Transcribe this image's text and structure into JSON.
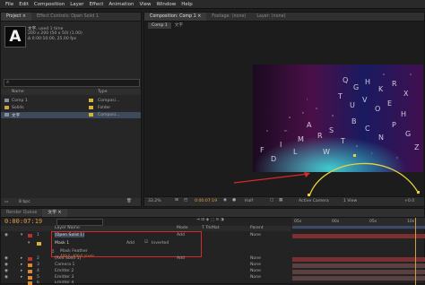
{
  "menu": [
    "File",
    "Edit",
    "Composition",
    "Layer",
    "Effect",
    "Animation",
    "View",
    "Window",
    "Help"
  ],
  "project": {
    "tabs": [
      "Project ×",
      "Effect Controls: Open Solid 1"
    ],
    "item_title": "文字",
    "item_used": ", used 1 time",
    "item_dims": "200 x 200 (50 x 50) (1.00)",
    "item_dur": "Δ 0:00:10:00, 25.00 fps",
    "search_placeholder": "",
    "col_name": "Name",
    "col_type": "Type",
    "rows": [
      {
        "name": "Comp 1",
        "type": "Composi..."
      },
      {
        "name": "Solids",
        "type": "Folder"
      },
      {
        "name": "文字",
        "type": "Composi..."
      }
    ],
    "bpc": "8 bpc"
  },
  "comp": {
    "tabs": [
      "Composition: Comp 1 ×",
      "Footage: (none)",
      "Layer: (none)"
    ],
    "subtabs": [
      "Comp 1",
      "文字"
    ],
    "zoom": "33.2%",
    "time": "0:00:07:19",
    "res": "Half",
    "camera": "Active Camera",
    "views": "1 View",
    "offset": "+0.0"
  },
  "timeline": {
    "tabs": [
      "Render Queue",
      "文字 ×"
    ],
    "time": "0:00:07:19",
    "col_layer": "Layer Name",
    "col_mode": "Mode",
    "col_t": "T TrkMat",
    "col_parent": "Parent",
    "ruler": [
      "05s",
      "00s",
      "05s",
      "10s"
    ],
    "layers": [
      {
        "num": "1",
        "name": "[Open Solid 1]",
        "mode": "Add",
        "parent": "None",
        "color": "red"
      },
      {
        "num": "",
        "name": "Mask 1",
        "mode": "Add",
        "extra": "Inverted",
        "parent": "",
        "color": "yellow"
      },
      {
        "num": "",
        "name": "Mask Feather",
        "mode": "",
        "extra": "",
        "parent": "",
        "color": "none",
        "value": "400.0, 400.0 pixels"
      },
      {
        "num": "2",
        "name": "[Red Solid 1]",
        "mode": "Add",
        "parent": "None",
        "color": "red"
      },
      {
        "num": "3",
        "name": "Camera 1",
        "mode": "",
        "parent": "None",
        "color": "orange"
      },
      {
        "num": "4",
        "name": "Emitter 2",
        "mode": "",
        "parent": "None",
        "color": "orange"
      },
      {
        "num": "5",
        "name": "Emitter 3",
        "mode": "",
        "parent": "None",
        "color": "orange"
      },
      {
        "num": "6",
        "name": "Emitter 4",
        "mode": "",
        "parent": "None",
        "color": "orange"
      }
    ]
  },
  "colors": {
    "accent": "#e08a2a",
    "arc": "#e6d23a",
    "arrow": "#d42a2a",
    "timecode": "#e0a040"
  },
  "thumb_letter": "A"
}
